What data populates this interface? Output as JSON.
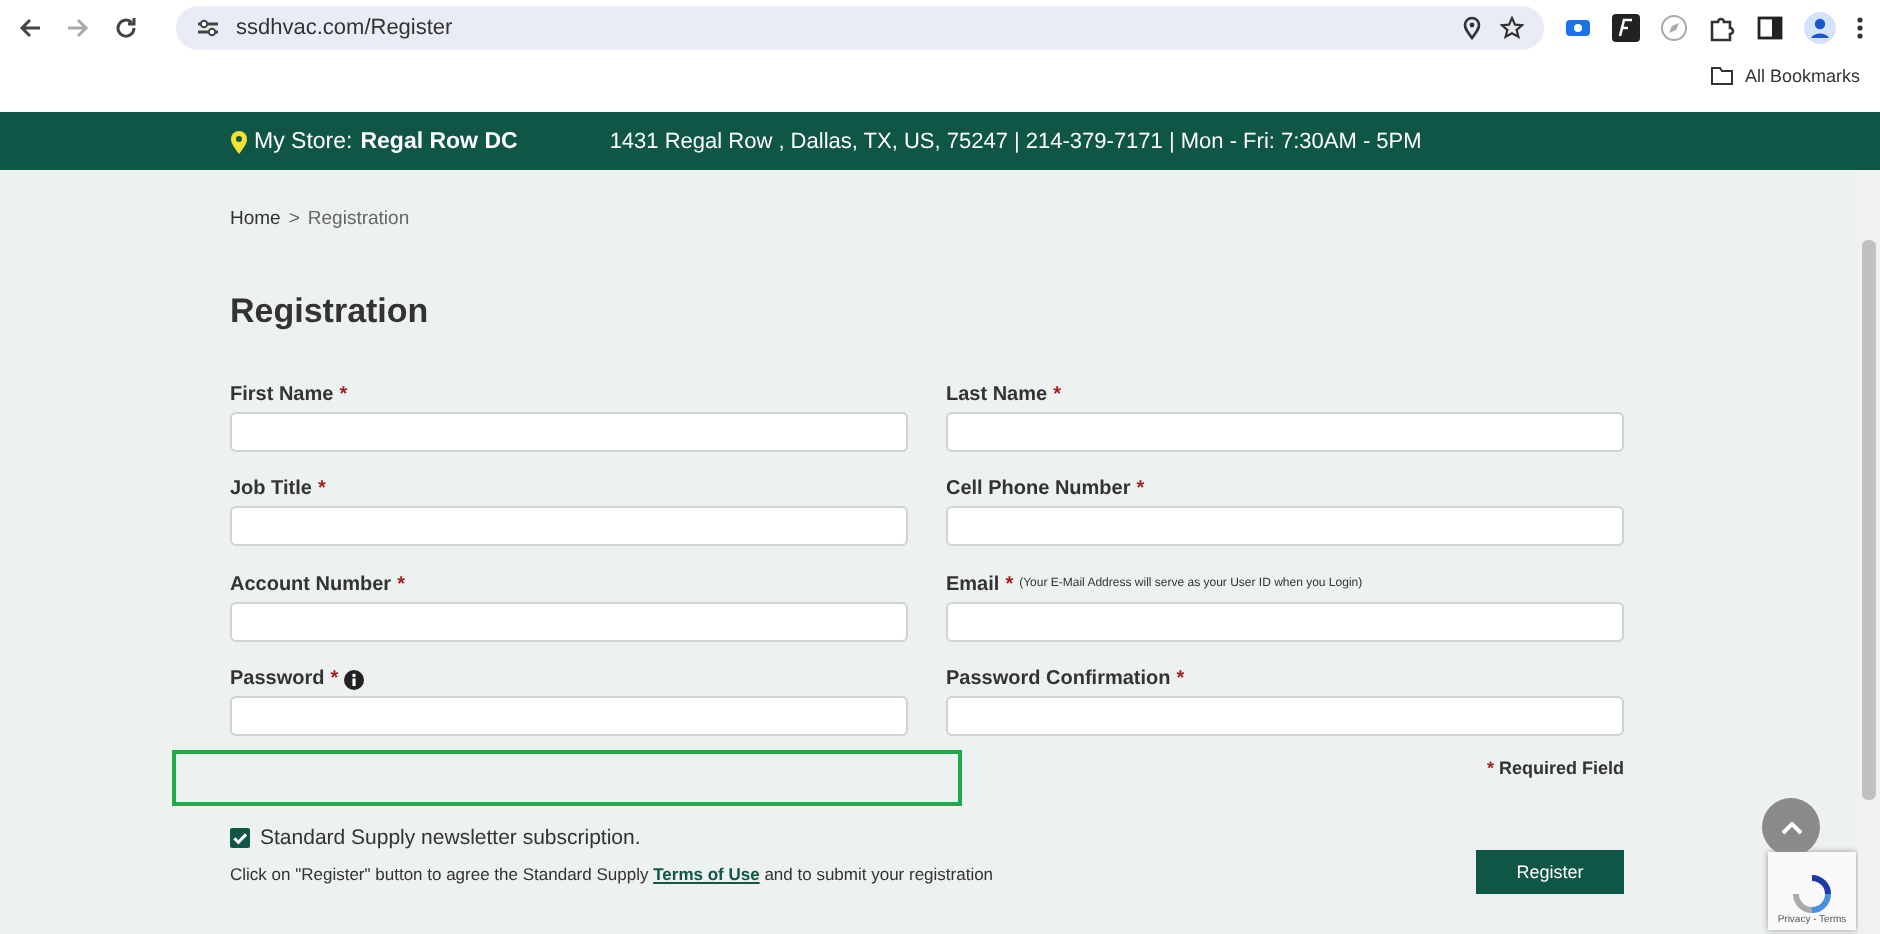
{
  "browser": {
    "url": "ssdhvac.com/Register",
    "bookmarks": "All Bookmarks"
  },
  "store_bar": {
    "label": "My Store:",
    "store": "Regal Row DC",
    "details": "1431 Regal Row , Dallas, TX, US, 75247 | 214-379-7171 | Mon - Fri: 7:30AM - 5PM"
  },
  "breadcrumb": {
    "home": "Home",
    "separator": ">",
    "current": "Registration"
  },
  "title": "Registration",
  "fields": [
    {
      "label": "First Name",
      "marker": "*"
    },
    {
      "label": "Last Name",
      "marker": "*"
    },
    {
      "label": "Job Title",
      "marker": "*"
    },
    {
      "label": "Cell Phone Number",
      "marker": "*"
    },
    {
      "label": "Account Number",
      "marker": "*"
    },
    {
      "label": "Email",
      "marker": "*",
      "note": "(Your E-Mail Address will serve as your User ID when you Login)"
    },
    {
      "label": "Password",
      "marker": "*",
      "info": true
    },
    {
      "label": "Password Confirmation",
      "marker": "*"
    }
  ],
  "required_note": {
    "marker": "*",
    "text": "Required Field"
  },
  "newsletter": {
    "label": "Standard Supply newsletter subscription.",
    "checked": true
  },
  "agreement": {
    "before": "Click on \"Register\" button to agree the Standard Supply",
    "link": "Terms of Use",
    "after": "and to submit your registration"
  },
  "register_button": "Register",
  "recaptcha": "Privacy - Terms"
}
